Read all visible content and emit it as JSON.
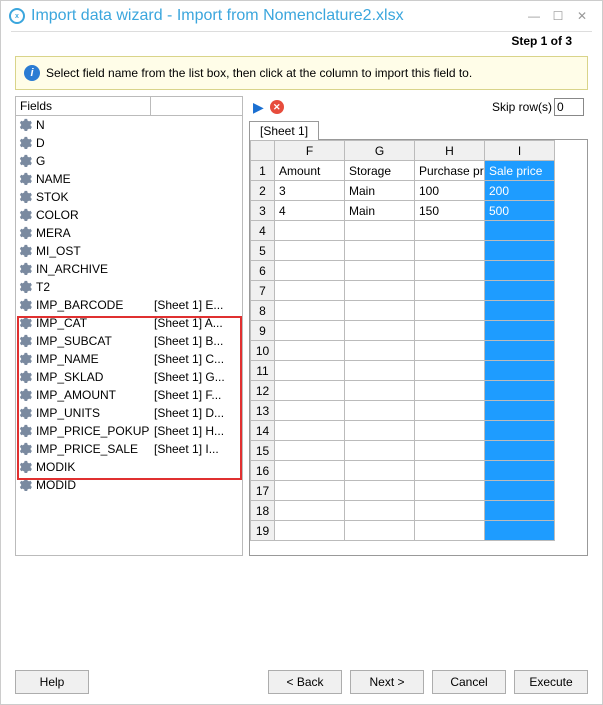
{
  "window": {
    "title": "Import data wizard - Import from Nomenclature2.xlsx",
    "step_label": "Step 1 of 3"
  },
  "instruction": "Select field name from the list box, then click at the column to import this field to.",
  "fields": {
    "header_col1": "Fields",
    "header_col2": "",
    "items": [
      {
        "name": "N",
        "mapping": ""
      },
      {
        "name": "D",
        "mapping": ""
      },
      {
        "name": "G",
        "mapping": ""
      },
      {
        "name": "NAME",
        "mapping": ""
      },
      {
        "name": "STOK",
        "mapping": ""
      },
      {
        "name": "COLOR",
        "mapping": ""
      },
      {
        "name": "MERA",
        "mapping": ""
      },
      {
        "name": "MI_OST",
        "mapping": ""
      },
      {
        "name": "IN_ARCHIVE",
        "mapping": ""
      },
      {
        "name": "T2",
        "mapping": ""
      },
      {
        "name": "IMP_BARCODE",
        "mapping": "[Sheet 1] E..."
      },
      {
        "name": "IMP_CAT",
        "mapping": "[Sheet 1] A..."
      },
      {
        "name": "IMP_SUBCAT",
        "mapping": "[Sheet 1] B..."
      },
      {
        "name": "IMP_NAME",
        "mapping": "[Sheet 1] C..."
      },
      {
        "name": "IMP_SKLAD",
        "mapping": "[Sheet 1] G..."
      },
      {
        "name": "IMP_AMOUNT",
        "mapping": "[Sheet 1] F..."
      },
      {
        "name": "IMP_UNITS",
        "mapping": "[Sheet 1] D..."
      },
      {
        "name": "IMP_PRICE_POKUP",
        "mapping": "[Sheet 1] H..."
      },
      {
        "name": "IMP_PRICE_SALE",
        "mapping": "[Sheet 1] I..."
      },
      {
        "name": "MODIK",
        "mapping": ""
      },
      {
        "name": "MODID",
        "mapping": ""
      }
    ]
  },
  "skip_rows": {
    "label": "Skip row(s)",
    "value": "0"
  },
  "sheet_tab": "[Sheet 1]",
  "grid": {
    "columns": [
      "F",
      "G",
      "H",
      "I"
    ],
    "selected_column": "I",
    "rows": [
      [
        "Amount",
        "Storage",
        "Purchase price",
        "Sale price"
      ],
      [
        "3",
        "Main",
        "100",
        "200"
      ],
      [
        "4",
        "Main",
        "150",
        "500"
      ],
      [
        "",
        "",
        "",
        ""
      ],
      [
        "",
        "",
        "",
        ""
      ],
      [
        "",
        "",
        "",
        ""
      ],
      [
        "",
        "",
        "",
        ""
      ],
      [
        "",
        "",
        "",
        ""
      ],
      [
        "",
        "",
        "",
        ""
      ],
      [
        "",
        "",
        "",
        ""
      ],
      [
        "",
        "",
        "",
        ""
      ],
      [
        "",
        "",
        "",
        ""
      ],
      [
        "",
        "",
        "",
        ""
      ],
      [
        "",
        "",
        "",
        ""
      ],
      [
        "",
        "",
        "",
        ""
      ],
      [
        "",
        "",
        "",
        ""
      ],
      [
        "",
        "",
        "",
        ""
      ],
      [
        "",
        "",
        "",
        ""
      ],
      [
        "",
        "",
        "",
        ""
      ]
    ]
  },
  "buttons": {
    "help": "Help",
    "back": "< Back",
    "next": "Next >",
    "cancel": "Cancel",
    "execute": "Execute"
  }
}
